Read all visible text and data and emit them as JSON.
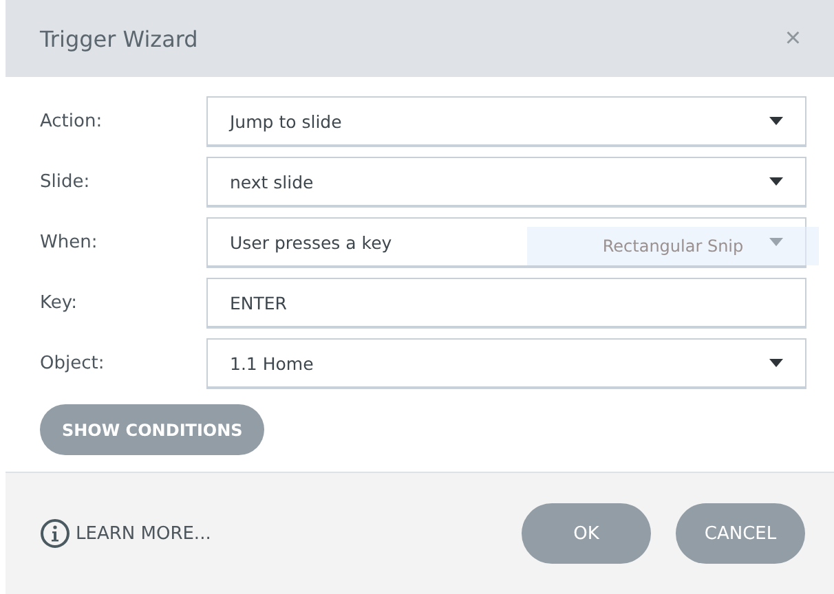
{
  "window": {
    "title": "Trigger Wizard",
    "close": "×"
  },
  "fields": [
    {
      "label": "Action:",
      "kind": "select",
      "value": "Jump to slide"
    },
    {
      "label": "Slide:",
      "kind": "select",
      "value": "next slide"
    },
    {
      "label": "When:",
      "kind": "select",
      "value": "User presses a key"
    },
    {
      "label": "Key:",
      "kind": "text",
      "value": "ENTER"
    },
    {
      "label": "Object:",
      "kind": "select",
      "value": "1.1 Home"
    }
  ],
  "show_conditions": "SHOW CONDITIONS",
  "tooltip": "Rectangular Snip",
  "footer": {
    "learn_more": "LEARN MORE...",
    "buttons": [
      "OK",
      "CANCEL"
    ]
  }
}
